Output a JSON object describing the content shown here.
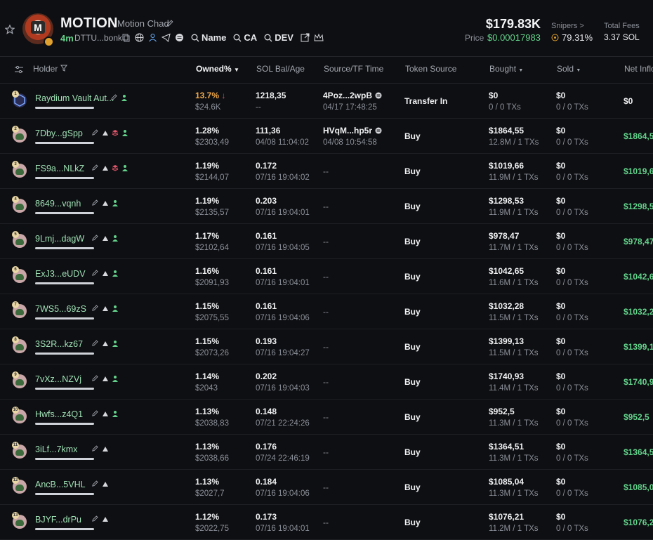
{
  "header": {
    "token_name": "MOTION",
    "token_subtitle": "Motion Chad",
    "age": "4m",
    "contract_short": "DTTU...bonk",
    "search_name": "Name",
    "search_ca": "CA",
    "search_dev": "DEV",
    "market_cap": "$179.83K",
    "price_label": "Price",
    "price_value": "$0.00017983",
    "snipers_label": "Snipers >",
    "snipers_value": "79.31%",
    "fees_label": "Total Fees",
    "fees_value": "3.37 SOL"
  },
  "columns": {
    "holder": "Holder",
    "owned": "Owned%",
    "sol_bal": "SOL Bal/Age",
    "source": "Source/TF Time",
    "token_source": "Token Source",
    "bought": "Bought",
    "sold": "Sold",
    "net_inflow": "Net Inflo"
  },
  "rows": [
    {
      "rank": "1",
      "holder": "Raydium Vault Aut...",
      "owned": "13.7%",
      "owned_usd": "$24.6K",
      "sol": "1218,35",
      "age": "--",
      "src": "4Poz...2wpB",
      "src_time": "04/17 17:48:25",
      "token_source": "Transfer In",
      "bought": "$0",
      "bought_tx": "0 / 0 TXs",
      "sold": "$0",
      "sold_tx": "0 / 0 TXs",
      "net": "$0"
    },
    {
      "rank": "2",
      "holder": "7Dby...gSpp",
      "owned": "1.28%",
      "owned_usd": "$2303,49",
      "sol": "111,36",
      "age": "04/08 11:04:02",
      "src": "HVqM...hp5r",
      "src_time": "04/08 10:54:58",
      "token_source": "Buy",
      "bought": "$1864,55",
      "bought_tx": "12.8M / 1 TXs",
      "sold": "$0",
      "sold_tx": "0 / 0 TXs",
      "net": "$1864,5"
    },
    {
      "rank": "3",
      "holder": "FS9a...NLkZ",
      "owned": "1.19%",
      "owned_usd": "$2144,07",
      "sol": "0.172",
      "age": "07/16 19:04:02",
      "src": "--",
      "src_time": "",
      "token_source": "Buy",
      "bought": "$1019,66",
      "bought_tx": "11.9M / 1 TXs",
      "sold": "$0",
      "sold_tx": "0 / 0 TXs",
      "net": "$1019,6"
    },
    {
      "rank": "4",
      "holder": "8649...vqnh",
      "owned": "1.19%",
      "owned_usd": "$2135,57",
      "sol": "0.203",
      "age": "07/16 19:04:01",
      "src": "--",
      "src_time": "",
      "token_source": "Buy",
      "bought": "$1298,53",
      "bought_tx": "11.9M / 1 TXs",
      "sold": "$0",
      "sold_tx": "0 / 0 TXs",
      "net": "$1298,5"
    },
    {
      "rank": "5",
      "holder": "9Lmj...dagW",
      "owned": "1.17%",
      "owned_usd": "$2102,64",
      "sol": "0.161",
      "age": "07/16 19:04:05",
      "src": "--",
      "src_time": "",
      "token_source": "Buy",
      "bought": "$978,47",
      "bought_tx": "11.7M / 1 TXs",
      "sold": "$0",
      "sold_tx": "0 / 0 TXs",
      "net": "$978,47"
    },
    {
      "rank": "6",
      "holder": "ExJ3...eUDV",
      "owned": "1.16%",
      "owned_usd": "$2091,93",
      "sol": "0.161",
      "age": "07/16 19:04:01",
      "src": "--",
      "src_time": "",
      "token_source": "Buy",
      "bought": "$1042,65",
      "bought_tx": "11.6M / 1 TXs",
      "sold": "$0",
      "sold_tx": "0 / 0 TXs",
      "net": "$1042,6"
    },
    {
      "rank": "7",
      "holder": "7WS5...69zS",
      "owned": "1.15%",
      "owned_usd": "$2075,55",
      "sol": "0.161",
      "age": "07/16 19:04:06",
      "src": "--",
      "src_time": "",
      "token_source": "Buy",
      "bought": "$1032,28",
      "bought_tx": "11.5M / 1 TXs",
      "sold": "$0",
      "sold_tx": "0 / 0 TXs",
      "net": "$1032,2"
    },
    {
      "rank": "8",
      "holder": "3S2R...kz67",
      "owned": "1.15%",
      "owned_usd": "$2073,26",
      "sol": "0.193",
      "age": "07/16 19:04:27",
      "src": "--",
      "src_time": "",
      "token_source": "Buy",
      "bought": "$1399,13",
      "bought_tx": "11.5M / 1 TXs",
      "sold": "$0",
      "sold_tx": "0 / 0 TXs",
      "net": "$1399,1"
    },
    {
      "rank": "9",
      "holder": "7vXz...NZVj",
      "owned": "1.14%",
      "owned_usd": "$2043",
      "sol": "0.202",
      "age": "07/16 19:04:03",
      "src": "--",
      "src_time": "",
      "token_source": "Buy",
      "bought": "$1740,93",
      "bought_tx": "11.4M / 1 TXs",
      "sold": "$0",
      "sold_tx": "0 / 0 TXs",
      "net": "$1740,9"
    },
    {
      "rank": "10",
      "holder": "Hwfs...z4Q1",
      "owned": "1.13%",
      "owned_usd": "$2038,83",
      "sol": "0.148",
      "age": "07/21 22:24:26",
      "src": "--",
      "src_time": "",
      "token_source": "Buy",
      "bought": "$952,5",
      "bought_tx": "11.3M / 1 TXs",
      "sold": "$0",
      "sold_tx": "0 / 0 TXs",
      "net": "$952,5"
    },
    {
      "rank": "11",
      "holder": "3iLf...7kmx",
      "owned": "1.13%",
      "owned_usd": "$2038,66",
      "sol": "0.176",
      "age": "07/24 22:46:19",
      "src": "--",
      "src_time": "",
      "token_source": "Buy",
      "bought": "$1364,51",
      "bought_tx": "11.3M / 1 TXs",
      "sold": "$0",
      "sold_tx": "0 / 0 TXs",
      "net": "$1364,5"
    },
    {
      "rank": "12",
      "holder": "AncB...5VHL",
      "owned": "1.13%",
      "owned_usd": "$2027,7",
      "sol": "0.184",
      "age": "07/16 19:04:06",
      "src": "--",
      "src_time": "",
      "token_source": "Buy",
      "bought": "$1085,04",
      "bought_tx": "11.3M / 1 TXs",
      "sold": "$0",
      "sold_tx": "0 / 0 TXs",
      "net": "$1085,0"
    },
    {
      "rank": "13",
      "holder": "BJYF...drPu",
      "owned": "1.12%",
      "owned_usd": "$2022,75",
      "sol": "0.173",
      "age": "07/16 19:04:01",
      "src": "--",
      "src_time": "",
      "token_source": "Buy",
      "bought": "$1076,21",
      "bought_tx": "11.2M / 1 TXs",
      "sold": "$0",
      "sold_tx": "0 / 0 TXs",
      "net": "$1076,2"
    }
  ]
}
